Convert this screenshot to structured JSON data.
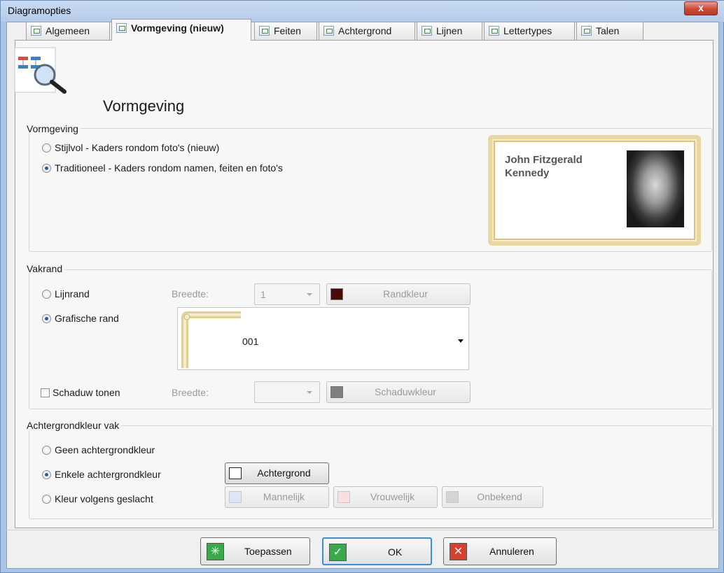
{
  "window": {
    "title": "Diagramopties",
    "close_label": "x"
  },
  "tabs": [
    {
      "label": "Algemeen"
    },
    {
      "label": "Vormgeving (nieuw)"
    },
    {
      "label": "Feiten"
    },
    {
      "label": "Achtergrond"
    },
    {
      "label": "Lijnen"
    },
    {
      "label": "Lettertypes"
    },
    {
      "label": "Talen"
    }
  ],
  "header": {
    "title": "Vormgeving"
  },
  "vormgeving": {
    "label": "Vormgeving",
    "options": [
      {
        "label": "Stijlvol - Kaders rondom foto's (nieuw)",
        "checked": false
      },
      {
        "label": "Traditioneel - Kaders rondom namen, feiten en foto's",
        "checked": true
      }
    ],
    "preview_name": "John Fitzgerald Kennedy"
  },
  "vakrand": {
    "label": "Vakrand",
    "lijnrand": "Lijnrand",
    "breedte_label": "Breedte:",
    "breedte_value": "1",
    "randkleur": "Randkleur",
    "randkleur_color": "#4a0a0a",
    "grafische_rand": "Grafische rand",
    "grafische_value": "001",
    "schaduw": "Schaduw tonen",
    "schaduw_breedte_label": "Breedte:",
    "schaduwkleur": "Schaduwkleur",
    "schaduwkleur_color": "#808080"
  },
  "achtergrond": {
    "label": "Achtergrondkleur vak",
    "geen": "Geen achtergrondkleur",
    "enkele": "Enkele achtergrondkleur",
    "geslacht": "Kleur volgens geslacht",
    "achtergrond_btn": "Achtergrond",
    "mannelijk": "Mannelijk",
    "vrouwelijk": "Vrouwelijk",
    "onbekend": "Onbekend",
    "colors": {
      "achtergrond": "#ffffff",
      "mannelijk": "#dde6f7",
      "vrouwelijk": "#f9e0e0",
      "onbekend": "#d4d4d4"
    }
  },
  "buttons": {
    "apply": "Toepassen",
    "ok": "OK",
    "cancel": "Annuleren"
  }
}
